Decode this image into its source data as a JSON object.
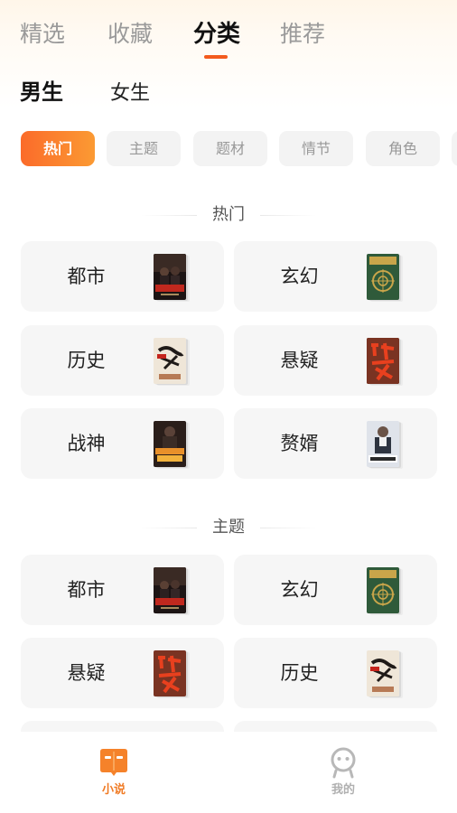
{
  "top_tabs": [
    {
      "label": "精选"
    },
    {
      "label": "收藏"
    },
    {
      "label": "分类"
    },
    {
      "label": "推荐"
    }
  ],
  "active_top_tab": "分类",
  "gender_tabs": [
    {
      "label": "男生"
    },
    {
      "label": "女生"
    }
  ],
  "active_gender": "男生",
  "filter_chips": [
    {
      "label": "热门"
    },
    {
      "label": "主题"
    },
    {
      "label": "题材"
    },
    {
      "label": "情节"
    },
    {
      "label": "角色"
    }
  ],
  "active_chip": "热门",
  "sections": [
    {
      "title": "热门",
      "items": [
        {
          "label": "都市",
          "cover_icon": "book-cover-dark-red-icon"
        },
        {
          "label": "玄幻",
          "cover_icon": "book-cover-green-compass-icon"
        },
        {
          "label": "历史",
          "cover_icon": "book-cover-beige-calligraphy-icon"
        },
        {
          "label": "悬疑",
          "cover_icon": "book-cover-red-calligraphy-icon"
        },
        {
          "label": "战神",
          "cover_icon": "book-cover-dark-figure-icon"
        },
        {
          "label": "赘婿",
          "cover_icon": "book-cover-light-figure-icon"
        }
      ]
    },
    {
      "title": "主题",
      "items": [
        {
          "label": "都市",
          "cover_icon": "book-cover-dark-red-icon"
        },
        {
          "label": "玄幻",
          "cover_icon": "book-cover-green-compass-icon"
        },
        {
          "label": "悬疑",
          "cover_icon": "book-cover-red-calligraphy-icon"
        },
        {
          "label": "历史",
          "cover_icon": "book-cover-beige-calligraphy-icon"
        }
      ]
    }
  ],
  "bottom_nav": [
    {
      "label": "小说",
      "icon": "book-icon",
      "active": true
    },
    {
      "label": "我的",
      "icon": "profile-icon",
      "active": false
    }
  ],
  "colors": {
    "accent": "#f35a1e",
    "chip_gradient_start": "#fb6b2a",
    "chip_gradient_end": "#fb9a33",
    "nav_active": "#f07b25",
    "card_bg": "#f6f6f6"
  }
}
